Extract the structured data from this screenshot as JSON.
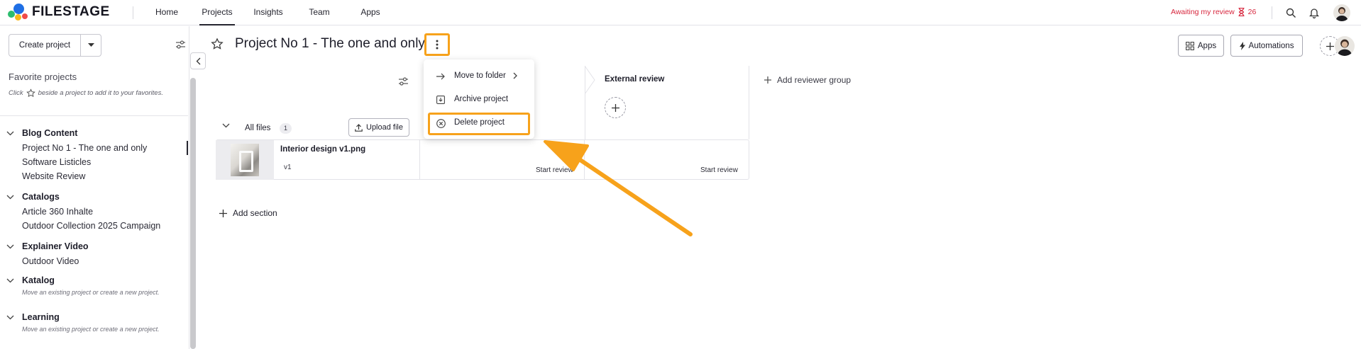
{
  "brand": {
    "name": "FILESTAGE"
  },
  "nav": {
    "items": [
      {
        "label": "Home"
      },
      {
        "label": "Projects"
      },
      {
        "label": "Insights"
      },
      {
        "label": "Team"
      },
      {
        "label": "Apps"
      }
    ],
    "active": "Projects"
  },
  "top": {
    "awaiting_label": "Awaiting my review",
    "awaiting_count": "26"
  },
  "sidebar": {
    "create_label": "Create project",
    "favorites_title": "Favorite projects",
    "favorites_hint_before": "Click",
    "favorites_hint_after": "beside a project to add it to your favorites.",
    "groups": [
      {
        "name": "Blog Content",
        "items": [
          "Project No 1 - The one and only",
          "Software Listicles",
          "Website Review"
        ]
      },
      {
        "name": "Catalogs",
        "items": [
          "Article 360 Inhalte",
          "Outdoor Collection 2025 Campaign"
        ]
      },
      {
        "name": "Explainer Video",
        "items": [
          "Outdoor Video"
        ]
      },
      {
        "name": "Katalog",
        "hint": "Move an existing project or create a new project."
      },
      {
        "name": "Learning",
        "hint": "Move an existing project or create a new project."
      }
    ],
    "selected_item": "Project No 1 - The one and only"
  },
  "project": {
    "title": "Project No 1 - The one and only",
    "apps_label": "Apps",
    "automations_label": "Automations"
  },
  "menu": {
    "items": [
      {
        "label": "Move to folder"
      },
      {
        "label": "Archive project"
      },
      {
        "label": "Delete project"
      }
    ]
  },
  "reviewers": {
    "external_label": "External review",
    "add_group_label": "Add reviewer group"
  },
  "section": {
    "name": "All files",
    "count": "1",
    "upload_label": "Upload file",
    "add_section_label": "Add section"
  },
  "file": {
    "name": "Interior design v1.png",
    "version": "v1",
    "start_review_label": "Start review"
  },
  "colors": {
    "highlight": "#f7a21b",
    "awaiting": "#d7263d",
    "logo_green": "#2dbd6e",
    "logo_blue": "#1f6fe5",
    "logo_yellow": "#f9b81b",
    "logo_red": "#ef4b4b"
  }
}
